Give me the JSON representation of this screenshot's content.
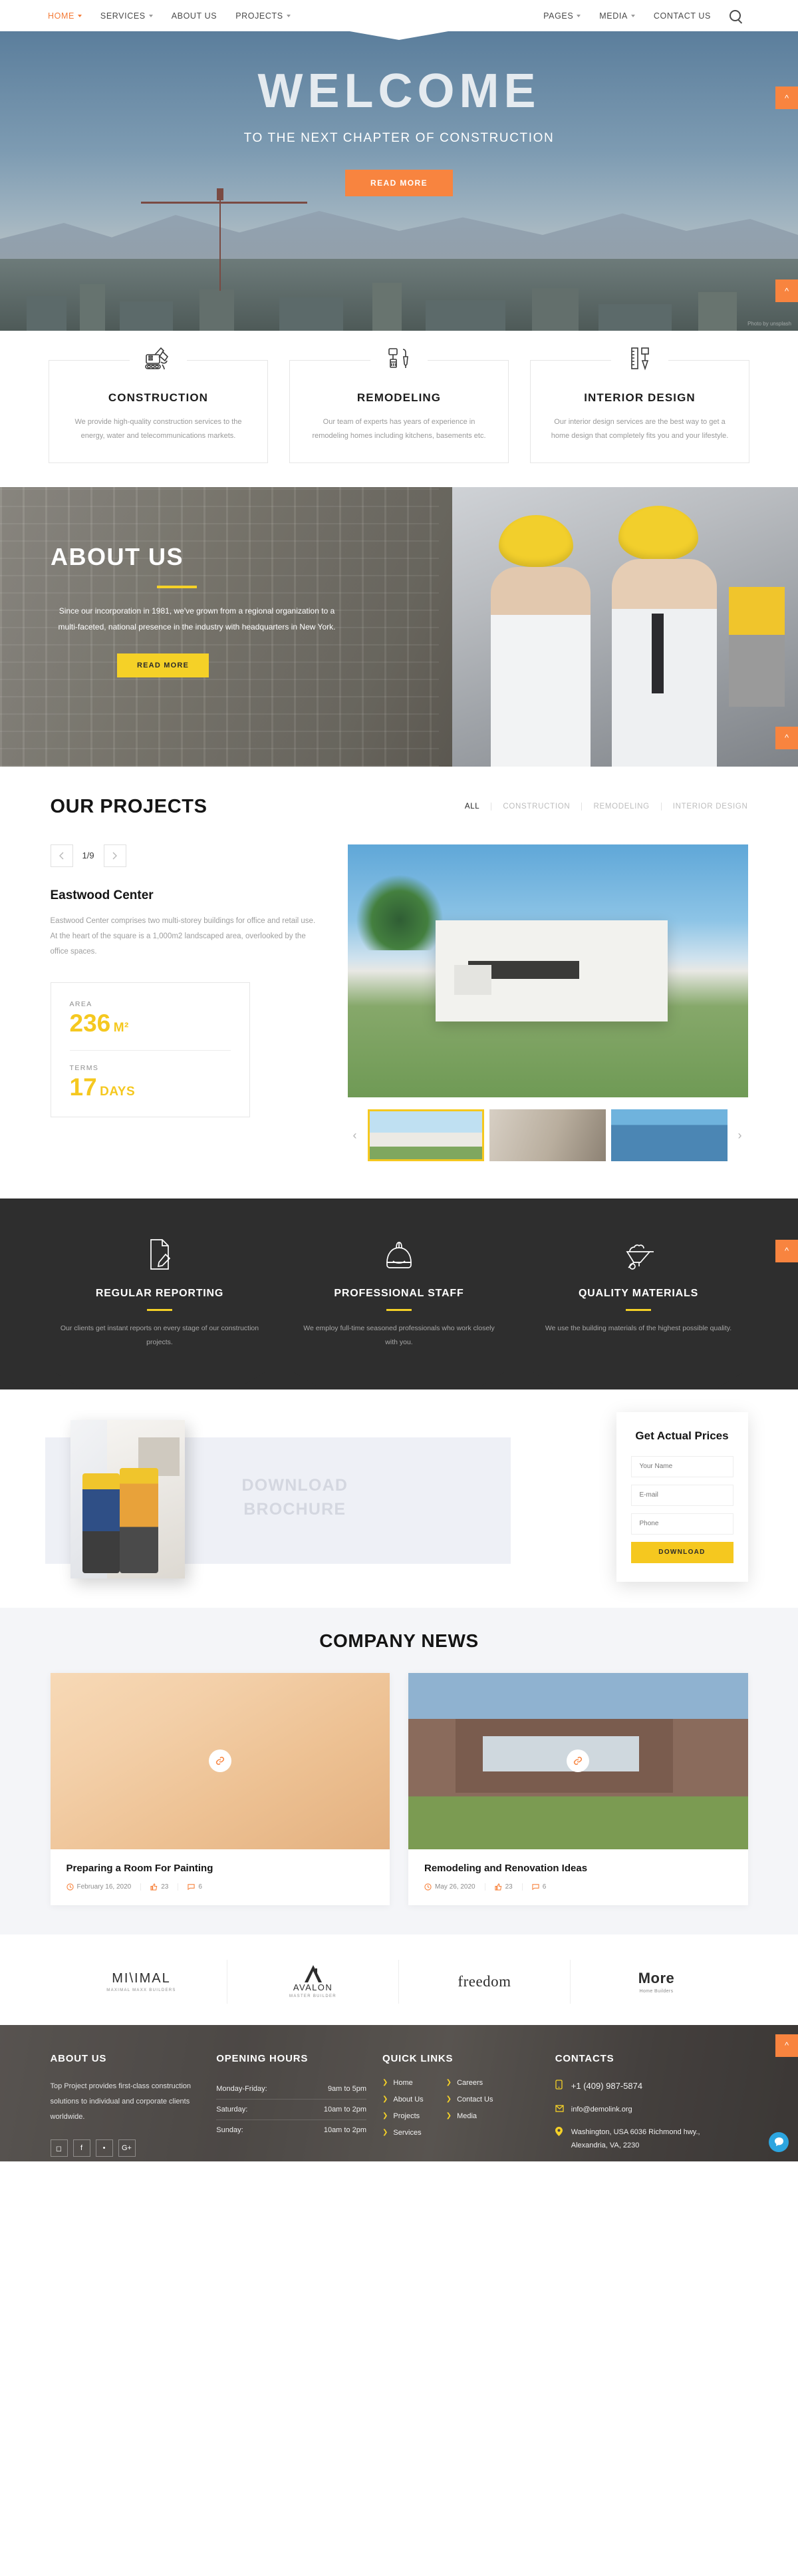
{
  "header": {
    "nav_left": [
      {
        "label": "HOME",
        "has_caret": true,
        "active": true
      },
      {
        "label": "SERVICES",
        "has_caret": true,
        "active": false
      },
      {
        "label": "ABOUT US",
        "has_caret": false,
        "active": false
      },
      {
        "label": "PROJECTS",
        "has_caret": true,
        "active": false
      }
    ],
    "nav_right": [
      {
        "label": "PAGES",
        "has_caret": true
      },
      {
        "label": "MEDIA",
        "has_caret": true
      },
      {
        "label": "CONTACT US",
        "has_caret": false
      }
    ],
    "search_icon": "search-icon"
  },
  "hero": {
    "title": "WELCOME",
    "subtitle": "TO THE NEXT CHAPTER OF CONSTRUCTION",
    "button": "READ MORE",
    "credit": "Photo by unsplash"
  },
  "services": [
    {
      "icon": "excavator-icon",
      "title": "CONSTRUCTION",
      "text": "We provide high-quality construction services to the energy, water and telecommunications markets."
    },
    {
      "icon": "paint-roller-icon",
      "title": "REMODELING",
      "text": "Our team of experts has years of experience in remodeling homes including kitchens, basements etc."
    },
    {
      "icon": "ruler-icon",
      "title": "INTERIOR DESIGN",
      "text": "Our interior design services are the best way to get a home design that completely fits you and your lifestyle."
    }
  ],
  "about": {
    "title": "ABOUT US",
    "text": "Since our incorporation in 1981, we've grown from a regional organization to a multi-faceted, national presence in the industry with headquarters in New York.",
    "button": "READ MORE"
  },
  "projects": {
    "heading": "OUR PROJECTS",
    "filters": [
      {
        "label": "ALL",
        "active": true
      },
      {
        "label": "CONSTRUCTION",
        "active": false
      },
      {
        "label": "REMODELING",
        "active": false
      },
      {
        "label": "INTERIOR DESIGN",
        "active": false
      }
    ],
    "counter": "1/9",
    "prev_icon": "chevron-left-icon",
    "next_icon": "chevron-right-icon",
    "name": "Eastwood Center",
    "description": "Eastwood Center comprises two multi-storey buildings for office and retail use. At the heart of the square is a 1,000m2 landscaped area, overlooked by the office spaces.",
    "stats": [
      {
        "label": "AREA",
        "value": "236",
        "unit": "M²"
      },
      {
        "label": "TERMS",
        "value": "17",
        "unit": "DAYS"
      }
    ],
    "thumb_prev_icon": "chevron-left-icon",
    "thumb_next_icon": "chevron-right-icon"
  },
  "features": [
    {
      "icon": "report-document-icon",
      "title": "REGULAR REPORTING",
      "text": "Our clients get instant reports on every stage of our construction projects."
    },
    {
      "icon": "hard-hat-icon",
      "title": "PROFESSIONAL STAFF",
      "text": "We employ full-time seasoned professionals who work closely with you."
    },
    {
      "icon": "wheelbarrow-icon",
      "title": "QUALITY MATERIALS",
      "text": "We use the building materials of the highest possible quality."
    }
  ],
  "brochure": {
    "line1": "DOWNLOAD",
    "line2": "BROCHURE"
  },
  "price_form": {
    "title": "Get Actual Prices",
    "name_placeholder": "Your Name",
    "email_placeholder": "E-mail",
    "phone_placeholder": "Phone",
    "submit": "DOWNLOAD"
  },
  "news": {
    "heading": "COMPANY NEWS",
    "posts": [
      {
        "title": "Preparing a Room For Painting",
        "date": "February 16, 2020",
        "likes": "23",
        "comments": "6",
        "link_icon": "link-icon",
        "clock_icon": "clock-icon",
        "like_icon": "thumbs-up-icon",
        "comment_icon": "comment-icon"
      },
      {
        "title": "Remodeling and Renovation Ideas",
        "date": "May 26, 2020",
        "likes": "23",
        "comments": "6",
        "link_icon": "link-icon",
        "clock_icon": "clock-icon",
        "like_icon": "thumbs-up-icon",
        "comment_icon": "comment-icon"
      }
    ]
  },
  "partners": [
    {
      "name": "MI\\IMAL",
      "sub": "MAXIMAL MAXX BUILDERS"
    },
    {
      "name": "AVALON",
      "sub": "MASTER BUILDER"
    },
    {
      "name": "freedom",
      "sub": ""
    },
    {
      "name": "More",
      "sub": "Home Builders"
    }
  ],
  "footer": {
    "about": {
      "heading": "ABOUT US",
      "text": "Top Project provides first-class construction solutions to individual and corporate clients worldwide.",
      "socials": [
        "instagram-icon",
        "facebook-icon",
        "twitter-icon",
        "google-plus-icon"
      ]
    },
    "hours": {
      "heading": "OPENING HOURS",
      "rows": [
        {
          "day": "Monday-Friday:",
          "time": "9am to 5pm"
        },
        {
          "day": "Saturday:",
          "time": "10am to 2pm"
        },
        {
          "day": "Sunday:",
          "time": "10am to 2pm"
        }
      ]
    },
    "quick_links": {
      "heading": "QUICK LINKS",
      "col1": [
        "Home",
        "About Us",
        "Projects",
        "Services"
      ],
      "col2": [
        "Careers",
        "Contact Us",
        "Media"
      ]
    },
    "contacts": {
      "heading": "CONTACTS",
      "phone": "+1 (409) 987-5874",
      "email": "info@demolink.org",
      "address": "Washington, USA 6036 Richmond hwy., Alexandria, VA, 2230",
      "phone_icon": "phone-icon",
      "email_icon": "envelope-icon",
      "address_icon": "map-pin-icon"
    }
  },
  "widgets": {
    "scroll_up": "^",
    "chat_icon": "chat-icon"
  },
  "colors": {
    "orange": "#f8843f",
    "yellow": "#f5c81f",
    "dark": "#2e2e2e"
  }
}
